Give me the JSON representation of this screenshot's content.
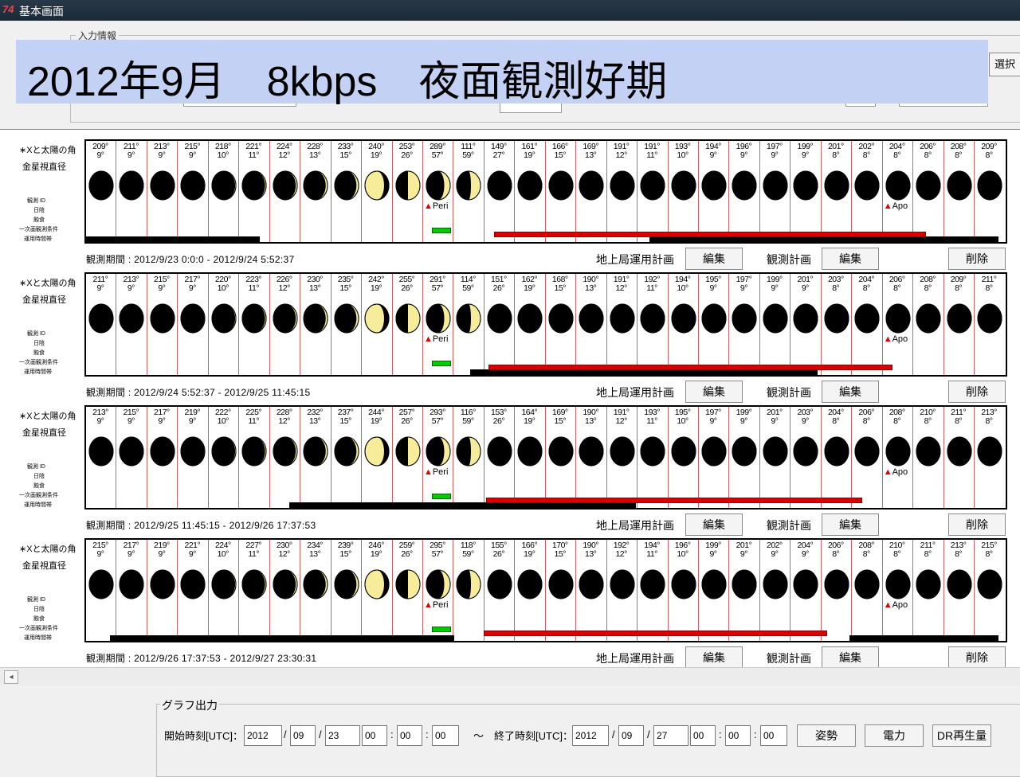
{
  "window": {
    "title": "基本画面",
    "app_icon": "74"
  },
  "input_group": {
    "legend": "入力情報",
    "select_label": "選択"
  },
  "banner": {
    "text": "2012年9月　8kbps　夜面観測好期",
    "bg_color": "#c3d2f4"
  },
  "row_labels": {
    "sun_angle": "∗Xと太陽の角",
    "venus_diameter": "金星視直径",
    "obs_id": "観測 ID",
    "sunrise": "日陰",
    "eclipse": "蝕食",
    "secondary": "一次画観測条件",
    "ops_time": "運用時間帯"
  },
  "colors": {
    "phase_line": "#d06060",
    "red_bar": "#dd0000",
    "green_mark": "#00cc00",
    "black_bar": "#000000",
    "moon_lit": "#f6ec9a"
  },
  "action_labels": {
    "ground_plan": "地上局運用計画",
    "edit": "編集",
    "obs_plan": "観測計画",
    "delete": "削除"
  },
  "markers": {
    "peri": "Peri",
    "apo": "Apo"
  },
  "strips": [
    {
      "period": "観測期間 : 2012/9/23 0:0:0 - 2012/9/24 5:52:37",
      "angles": [
        "209°",
        "211°",
        "213°",
        "215°",
        "218°",
        "221°",
        "224°",
        "228°",
        "233°",
        "240°",
        "253°",
        "289°",
        "111°",
        "149°",
        "161°",
        "166°",
        "169°",
        "191°",
        "191°",
        "193°",
        "194°",
        "196°",
        "197°",
        "199°",
        "201°",
        "202°",
        "204°",
        "206°",
        "208°",
        "209°"
      ],
      "diameters": [
        "9°",
        "9°",
        "9°",
        "9°",
        "10°",
        "11°",
        "12°",
        "13°",
        "15°",
        "19°",
        "26°",
        "57°",
        "59°",
        "27°",
        "19°",
        "15°",
        "13°",
        "12°",
        "11°",
        "10°",
        "9°",
        "9°",
        "9°",
        "9°",
        "8°",
        "8°",
        "8°",
        "8°",
        "8°",
        "8°"
      ]
    },
    {
      "period": "観測期間 : 2012/9/24 5:52:37 - 2012/9/25 11:45:15",
      "angles": [
        "211°",
        "213°",
        "215°",
        "217°",
        "220°",
        "223°",
        "226°",
        "230°",
        "235°",
        "242°",
        "255°",
        "291°",
        "114°",
        "151°",
        "162°",
        "168°",
        "190°",
        "191°",
        "192°",
        "194°",
        "195°",
        "197°",
        "199°",
        "201°",
        "203°",
        "204°",
        "206°",
        "208°",
        "209°",
        "211°"
      ],
      "diameters": [
        "9°",
        "9°",
        "9°",
        "9°",
        "10°",
        "11°",
        "12°",
        "13°",
        "15°",
        "19°",
        "26°",
        "57°",
        "59°",
        "26°",
        "19°",
        "15°",
        "13°",
        "12°",
        "11°",
        "10°",
        "9°",
        "9°",
        "9°",
        "9°",
        "8°",
        "8°",
        "8°",
        "8°",
        "8°",
        "8°"
      ]
    },
    {
      "period": "観測期間 : 2012/9/25 11:45:15 - 2012/9/26 17:37:53",
      "angles": [
        "213°",
        "215°",
        "217°",
        "219°",
        "222°",
        "225°",
        "228°",
        "232°",
        "237°",
        "244°",
        "257°",
        "293°",
        "116°",
        "153°",
        "164°",
        "169°",
        "190°",
        "191°",
        "193°",
        "195°",
        "197°",
        "199°",
        "201°",
        "203°",
        "204°",
        "206°",
        "208°",
        "210°",
        "211°",
        "213°"
      ],
      "diameters": [
        "9°",
        "9°",
        "9°",
        "9°",
        "10°",
        "11°",
        "12°",
        "13°",
        "15°",
        "19°",
        "26°",
        "57°",
        "59°",
        "26°",
        "19°",
        "15°",
        "13°",
        "12°",
        "11°",
        "10°",
        "9°",
        "9°",
        "9°",
        "9°",
        "8°",
        "8°",
        "8°",
        "8°",
        "8°",
        "8°"
      ]
    },
    {
      "period": "観測期間 : 2012/9/26 17:37:53 - 2012/9/27 23:30:31",
      "angles": [
        "215°",
        "217°",
        "219°",
        "221°",
        "224°",
        "227°",
        "230°",
        "234°",
        "239°",
        "246°",
        "259°",
        "295°",
        "118°",
        "155°",
        "166°",
        "170°",
        "190°",
        "192°",
        "194°",
        "196°",
        "199°",
        "201°",
        "202°",
        "204°",
        "206°",
        "208°",
        "210°",
        "211°",
        "213°",
        "215°"
      ],
      "diameters": [
        "9°",
        "9°",
        "9°",
        "9°",
        "10°",
        "11°",
        "12°",
        "13°",
        "15°",
        "19°",
        "26°",
        "57°",
        "59°",
        "26°",
        "19°",
        "15°",
        "13°",
        "12°",
        "11°",
        "10°",
        "9°",
        "9°",
        "9°",
        "9°",
        "8°",
        "8°",
        "8°",
        "8°",
        "8°",
        "8°"
      ]
    }
  ],
  "graph": {
    "legend": "グラフ出力",
    "start_label": "開始時刻[UTC]：",
    "end_label": "〜　終了時刻[UTC]：",
    "start": {
      "year": "2012",
      "month": "09",
      "day": "23",
      "hour": "00",
      "min": "00",
      "sec": "00"
    },
    "end": {
      "year": "2012",
      "month": "09",
      "day": "27",
      "hour": "00",
      "min": "00",
      "sec": "00"
    },
    "buttons": {
      "attitude": "姿勢",
      "power": "電力",
      "dr": "DR再生量"
    }
  }
}
